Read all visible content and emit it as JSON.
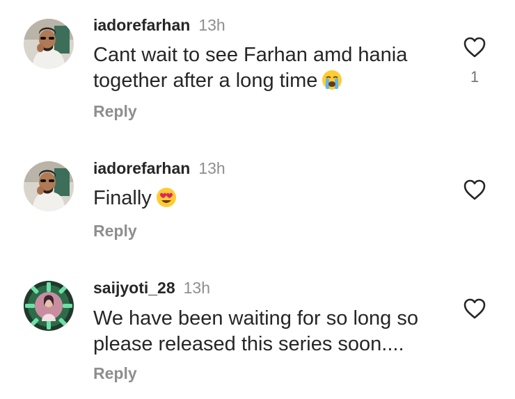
{
  "comments": [
    {
      "username": "iadorefarhan",
      "time": "13h",
      "text": "Cant wait to see Farhan amd hania together after a long time",
      "emoji": "loudly-crying-face-emoji",
      "like_count": "1",
      "reply_label": "Reply"
    },
    {
      "username": "iadorefarhan",
      "time": "13h",
      "text": "Finally",
      "emoji": "heart-eyes-emoji",
      "like_count": "",
      "reply_label": "Reply"
    },
    {
      "username": "saijyoti_28",
      "time": "13h",
      "text": "We have been waiting for so long so please released this series soon....",
      "emoji": "",
      "like_count": "",
      "reply_label": "Reply"
    }
  ],
  "icons": {
    "like": "heart-outline-icon"
  },
  "colors": {
    "primary_text": "#262626",
    "secondary_text": "#8e8e8e",
    "icon_stroke": "#262626"
  }
}
